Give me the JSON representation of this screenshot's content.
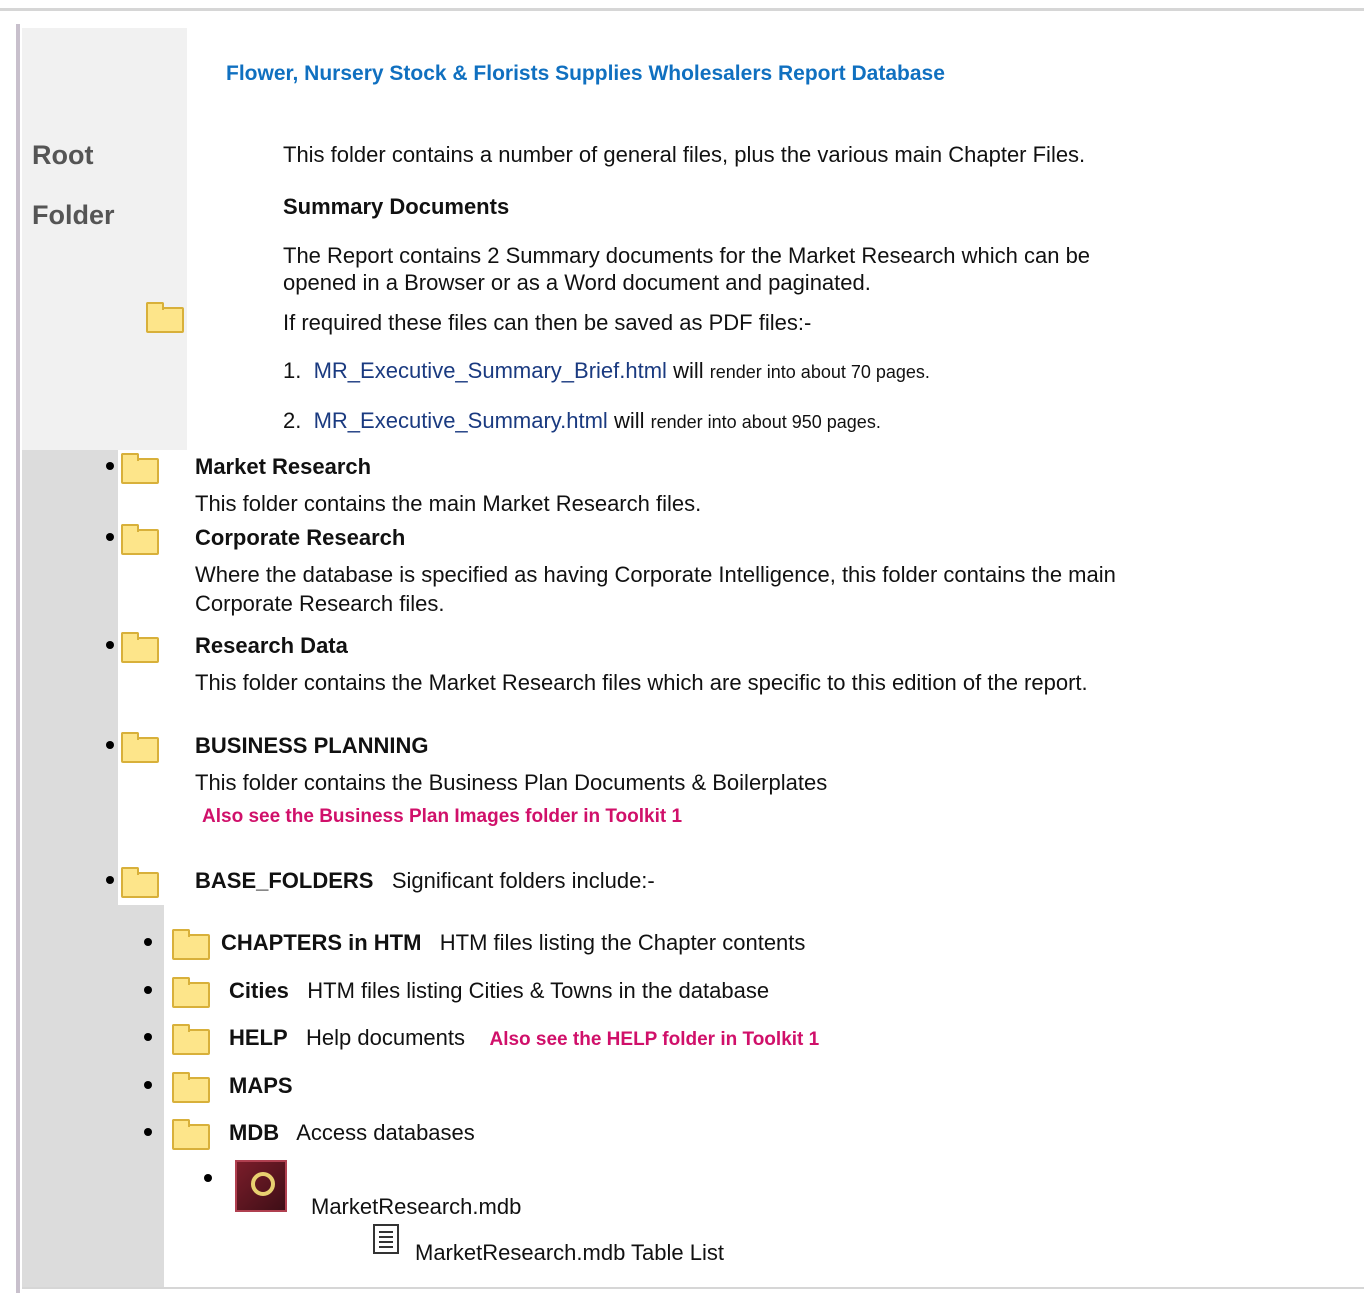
{
  "title": "Flower, Nursery Stock & Florists Supplies Wholesalers Report Database",
  "root_label_1": "Root",
  "root_label_2": "Folder",
  "root_desc": "This folder contains a number of general files, plus the various main Chapter Files.",
  "summary_heading": "Summary Documents",
  "summary_line1": "The Report contains 2 Summary documents for the Market Research which can be",
  "summary_line2": "opened in a Browser or as a Word document and paginated.",
  "pdf_note": "If required these files can then be saved as PDF files:-",
  "summary_files": [
    {
      "num": "1.",
      "link": "MR_Executive_Summary_Brief.html",
      "will": "will",
      "rest": "render into about 70 pages."
    },
    {
      "num": "2.",
      "link": "MR_Executive_Summary.html",
      "will": "will",
      "rest": "render into about 950 pages."
    }
  ],
  "folders": {
    "market_research": {
      "name": "Market Research",
      "desc": "This folder contains the main Market Research files."
    },
    "corporate_research": {
      "name": "Corporate Research",
      "desc_line1": "Where the database is specified as having Corporate Intelligence, this folder contains the main",
      "desc_line2": "Corporate Research files."
    },
    "research_data": {
      "name": "Research Data",
      "desc": "This folder contains the Market Research files which are specific to this edition of the report."
    },
    "business_planning": {
      "name": "BUSINESS PLANNING",
      "desc": "This folder contains the Business Plan Documents & Boilerplates",
      "note": "Also see the Business Plan Images folder in Toolkit 1"
    },
    "base_folders": {
      "name": "BASE_FOLDERS",
      "desc": "Significant folders include:-"
    }
  },
  "subfolders": [
    {
      "name": "CHAPTERS in HTM",
      "desc": "HTM files listing the Chapter contents",
      "note": ""
    },
    {
      "name": "Cities",
      "desc": "HTM files listing Cities & Towns in the database",
      "note": ""
    },
    {
      "name": "HELP",
      "desc": "Help documents",
      "note": "Also see the HELP folder in Toolkit 1"
    },
    {
      "name": "MAPS",
      "desc": "",
      "note": ""
    },
    {
      "name": "MDB",
      "desc": "Access databases",
      "note": ""
    }
  ],
  "mdb_file": "MarketResearch.mdb",
  "mdb_table_list": "MarketResearch.mdb Table List"
}
